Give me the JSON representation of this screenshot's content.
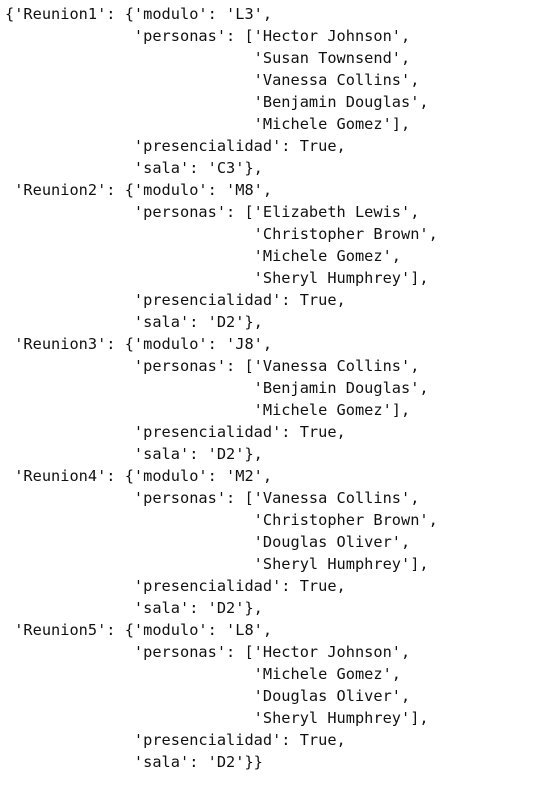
{
  "lines": [
    "{'Reunion1': {'modulo': 'L3',",
    "              'personas': ['Hector Johnson',",
    "                           'Susan Townsend',",
    "                           'Vanessa Collins',",
    "                           'Benjamin Douglas',",
    "                           'Michele Gomez'],",
    "              'presencialidad': True,",
    "              'sala': 'C3'},",
    " 'Reunion2': {'modulo': 'M8',",
    "              'personas': ['Elizabeth Lewis',",
    "                           'Christopher Brown',",
    "                           'Michele Gomez',",
    "                           'Sheryl Humphrey'],",
    "              'presencialidad': True,",
    "              'sala': 'D2'},",
    " 'Reunion3': {'modulo': 'J8',",
    "              'personas': ['Vanessa Collins',",
    "                           'Benjamin Douglas',",
    "                           'Michele Gomez'],",
    "              'presencialidad': True,",
    "              'sala': 'D2'},",
    " 'Reunion4': {'modulo': 'M2',",
    "              'personas': ['Vanessa Collins',",
    "                           'Christopher Brown',",
    "                           'Douglas Oliver',",
    "                           'Sheryl Humphrey'],",
    "              'presencialidad': True,",
    "              'sala': 'D2'},",
    " 'Reunion5': {'modulo': 'L8',",
    "              'personas': ['Hector Johnson',",
    "                           'Michele Gomez',",
    "                           'Douglas Oliver',",
    "                           'Sheryl Humphrey'],",
    "              'presencialidad': True,",
    "              'sala': 'D2'}}"
  ]
}
